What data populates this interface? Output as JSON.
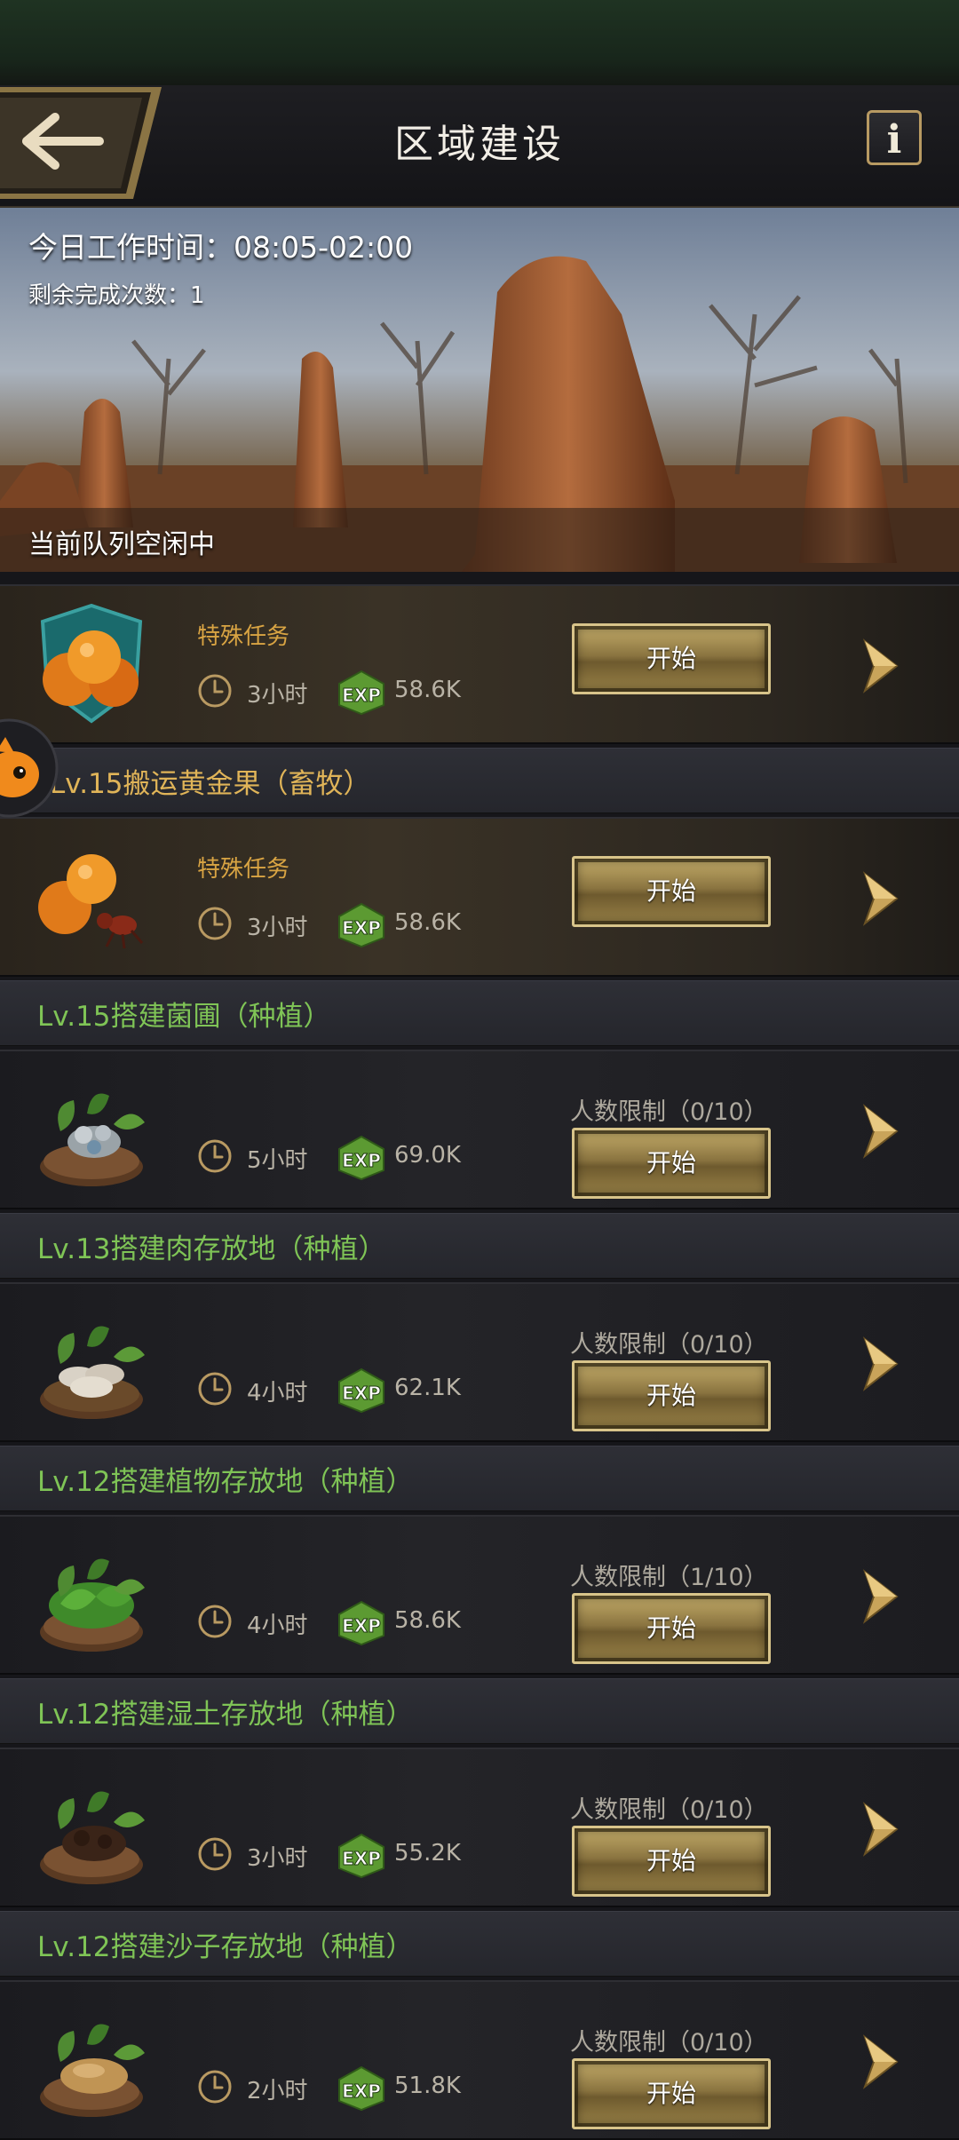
{
  "header": {
    "title": "区域建设",
    "back_icon": "back-arrow-icon",
    "info_label": "i"
  },
  "banner": {
    "work_time": "今日工作时间：08:05-02:00",
    "remaining": "剩余完成次数：1",
    "queue_status": "当前队列空闲中"
  },
  "common": {
    "start_label": "开始",
    "exp_label": "EXP",
    "special_label": "特殊任务"
  },
  "tasks": [
    {
      "section": "",
      "special": true,
      "icon": "golden-fruit-icon",
      "duration": "3小时",
      "exp": "58.6K",
      "limit": ""
    },
    {
      "section": "Lv.15搬运黄金果（畜牧）",
      "special": true,
      "icon": "golden-fruit-ant-icon",
      "duration": "3小时",
      "exp": "58.6K",
      "limit": ""
    },
    {
      "section": "Lv.15搭建菌圃（种植）",
      "special": false,
      "icon": "fungus-garden-icon",
      "duration": "5小时",
      "exp": "69.0K",
      "limit": "人数限制（0/10）"
    },
    {
      "section": "Lv.13搭建肉存放地（种植）",
      "special": false,
      "icon": "meat-storage-icon",
      "duration": "4小时",
      "exp": "62.1K",
      "limit": "人数限制（0/10）"
    },
    {
      "section": "Lv.12搭建植物存放地（种植）",
      "special": false,
      "icon": "plant-storage-icon",
      "duration": "4小时",
      "exp": "58.6K",
      "limit": "人数限制（1/10）"
    },
    {
      "section": "Lv.12搭建湿土存放地（种植）",
      "special": false,
      "icon": "wet-soil-storage-icon",
      "duration": "3小时",
      "exp": "55.2K",
      "limit": "人数限制（0/10）"
    },
    {
      "section": "Lv.12搭建沙子存放地（种植）",
      "special": false,
      "icon": "sand-storage-icon",
      "duration": "2小时",
      "exp": "51.8K",
      "limit": "人数限制（0/10）"
    }
  ],
  "colors": {
    "section_green": "#7fc456",
    "section_gold": "#e0b458",
    "special_orange": "#d9a443",
    "button_gold": "#c5ad6a"
  }
}
